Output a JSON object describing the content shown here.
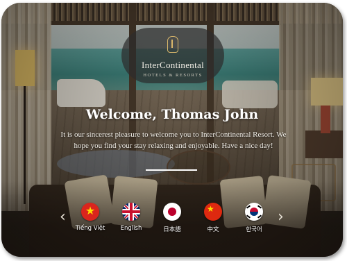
{
  "logo": {
    "title": "InterContinental",
    "subtitle": "HOTELS & RESORTS"
  },
  "welcome": {
    "heading": "Welcome, Thomas John",
    "message": "It is our sincerest pleasure to welcome you to InterContinental Resort. We hope you find your stay relaxing and enjoyable. Have a nice day!"
  },
  "languages": {
    "prev_icon": "chevron-left-icon",
    "next_icon": "chevron-right-icon",
    "items": [
      {
        "label": "Tiếng Việt",
        "flag": "vietnam-flag-icon"
      },
      {
        "label": "English",
        "flag": "uk-flag-icon"
      },
      {
        "label": "日本語",
        "flag": "japan-flag-icon"
      },
      {
        "label": "中文",
        "flag": "china-flag-icon"
      },
      {
        "label": "한국어",
        "flag": "korea-flag-icon"
      }
    ]
  },
  "colors": {
    "logo_accent": "#d9b76b",
    "text": "#ffffff",
    "pill_background": "#2d2d2d"
  }
}
